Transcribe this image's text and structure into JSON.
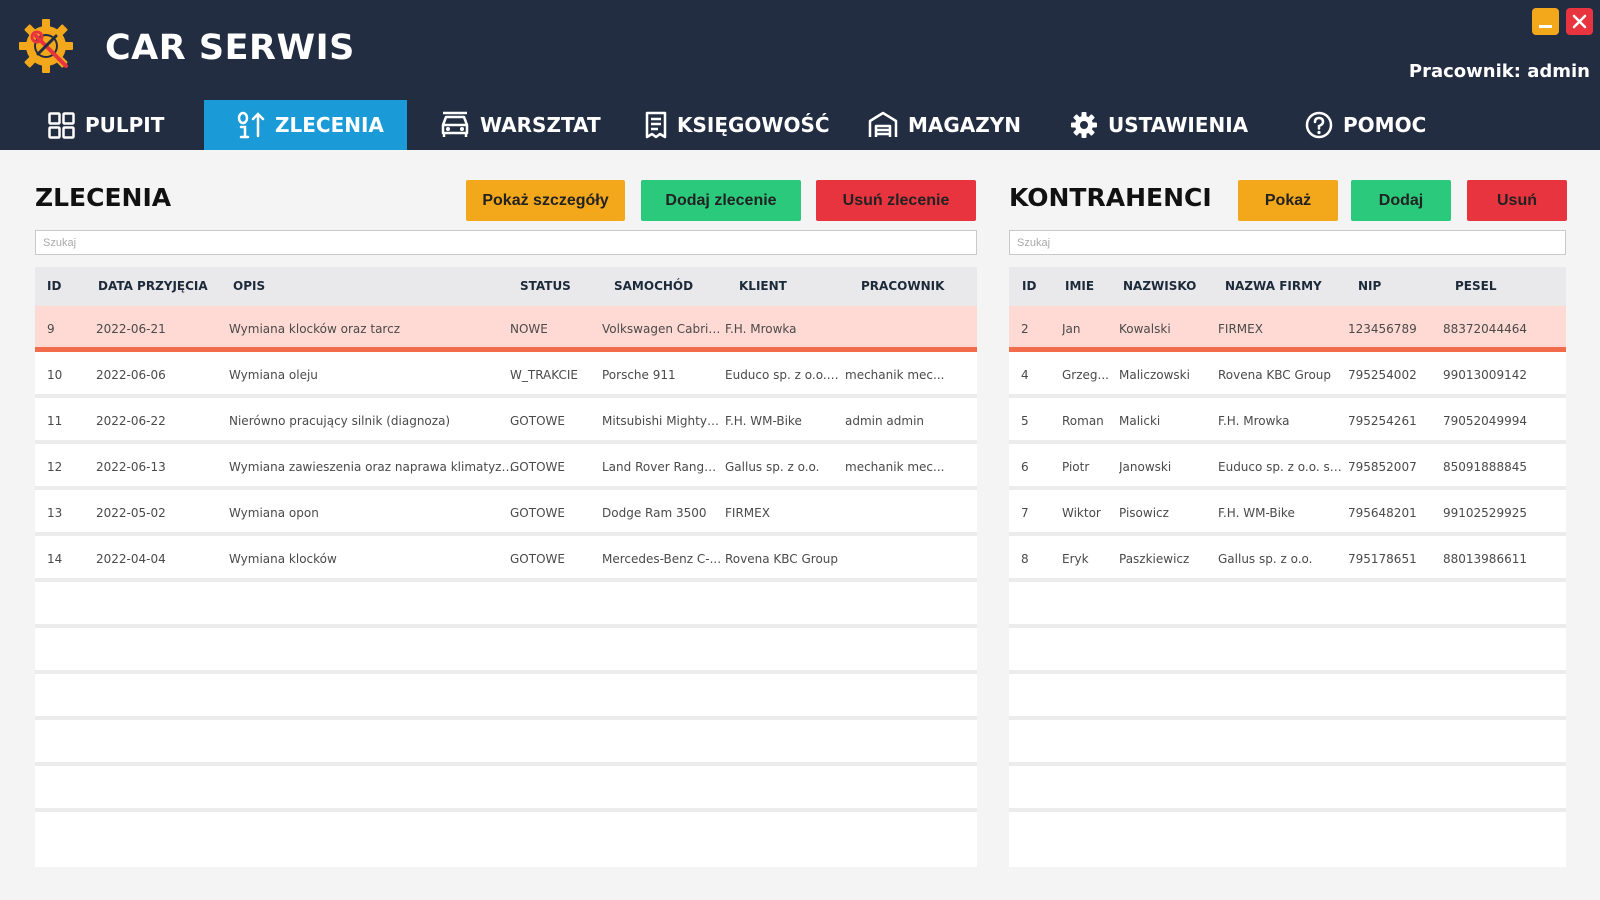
{
  "app": {
    "title": "CAR SERWIS",
    "user": "Pracownik: admin"
  },
  "window": {
    "minimize_icon": "minimize-icon",
    "close_icon": "close-icon"
  },
  "nav": [
    {
      "label": "PULPIT",
      "icon": "dashboard-grid-icon",
      "active": false
    },
    {
      "label": "ZLECENIA",
      "icon": "sort-numeric-icon",
      "active": true
    },
    {
      "label": "WARSZTAT",
      "icon": "car-icon",
      "active": false
    },
    {
      "label": "KSIĘGOWOŚĆ",
      "icon": "receipt-icon",
      "active": false
    },
    {
      "label": "MAGAZYN",
      "icon": "warehouse-icon",
      "active": false
    },
    {
      "label": "USTAWIENIA",
      "icon": "gear-icon",
      "active": false
    },
    {
      "label": "POMOC",
      "icon": "help-icon",
      "active": false
    }
  ],
  "orders": {
    "title": "ZLECENIA",
    "show_label": "Pokaż szczegóły",
    "add_label": "Dodaj zlecenie",
    "delete_label": "Usuń zlecenie",
    "search_placeholder": "Szukaj",
    "columns": [
      "ID",
      "DATA PRZYJĘCIA",
      "OPIS",
      "STATUS",
      "SAMOCHÓD",
      "KLIENT",
      "PRACOWNIK"
    ],
    "rows": [
      [
        "9",
        "2022-06-21",
        "Wymiana klocków oraz tarcz",
        "NOWE",
        "Volkswagen Cabrio...",
        "F.H. Mrowka",
        ""
      ],
      [
        "10",
        "2022-06-06",
        "Wymiana oleju",
        "W_TRAKCIE",
        "Porsche 911",
        "Euduco sp. z o.o. s...",
        "mechanik mec..."
      ],
      [
        "11",
        "2022-06-22",
        "Nierówno pracujący silnik (diagnoza)",
        "GOTOWE",
        "Mitsubishi Mighty ...",
        "F.H. WM-Bike",
        "admin admin"
      ],
      [
        "12",
        "2022-06-13",
        "Wymiana zawieszenia oraz naprawa klimatyzacji",
        "GOTOWE",
        "Land Rover Range ...",
        "Gallus sp. z o.o.",
        "mechanik mec..."
      ],
      [
        "13",
        "2022-05-02",
        "Wymiana opon",
        "GOTOWE",
        "Dodge Ram 3500",
        "FIRMEX",
        ""
      ],
      [
        "14",
        "2022-04-04",
        "Wymiana klocków",
        "GOTOWE",
        "Mercedes-Benz C-...",
        "Rovena KBC Group",
        ""
      ]
    ],
    "selected_index": 0
  },
  "contractors": {
    "title": "KONTRAHENCI",
    "show_label": "Pokaż",
    "add_label": "Dodaj",
    "delete_label": "Usuń",
    "search_placeholder": "Szukaj",
    "columns": [
      "ID",
      "IMIE",
      "NAZWISKO",
      "NAZWA FIRMY",
      "NIP",
      "PESEL"
    ],
    "rows": [
      [
        "2",
        "Jan",
        "Kowalski",
        "FIRMEX",
        "123456789",
        "88372044464"
      ],
      [
        "4",
        "Grzeg...",
        "Maliczowski",
        "Rovena KBC Group",
        "795254002",
        "99013009142"
      ],
      [
        "5",
        "Roman",
        "Malicki",
        "F.H. Mrowka",
        "795254261",
        "79052049994"
      ],
      [
        "6",
        "Piotr",
        "Janowski",
        "Euduco sp. z o.o. sp. k.",
        "795852007",
        "85091888845"
      ],
      [
        "7",
        "Wiktor",
        "Pisowicz",
        "F.H. WM-Bike",
        "795648201",
        "99102529925"
      ],
      [
        "8",
        "Eryk",
        "Paszkiewicz",
        "Gallus sp. z o.o.",
        "795178651",
        "88013986611"
      ]
    ],
    "selected_index": 0
  },
  "colors": {
    "header": "#232d42",
    "nav_active": "#1a9bd7",
    "yellow": "#f3a81c",
    "green": "#2bc97c",
    "red": "#e8343f",
    "selected_row": "#ffd9d3",
    "selected_border": "#f26b4a"
  }
}
